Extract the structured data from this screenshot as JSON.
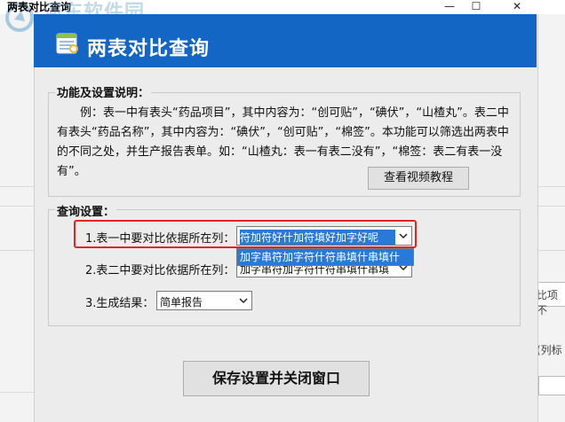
{
  "window": {
    "title": "两表对比查询",
    "minimize": "—",
    "maximize": "☐",
    "close": "✕",
    "watermark": "河东软件园"
  },
  "header": {
    "title": "两表对比查询"
  },
  "description": {
    "group_label": "功能及设置说明：",
    "text": "　　例：表一中有表头“药品项目”，其中内容为：“创可贴”，“碘伏”，“山楂丸”。表二中有表头“药品名称”，其中内容为：“碘伏”，“创可贴”，“棉签”。本功能可以筛选出两表中的不同之处，并生产报告表单。如：“山楂丸：表一有表二没有”，“棉签：表二有表一没有”。",
    "video_button": "查看视频教程"
  },
  "query": {
    "group_label": "查询设置：",
    "row1_label": "1.表一中要对比依据所在列：",
    "row1_value": "符加符好什加符填好加字好呢",
    "row2_label": "2.表二中要对比依据所在列：",
    "row2_value": "加字串符加字符什符串填什串填",
    "dropdown_item": "加字串符加字符什符串填什串填什",
    "row3_label": "3.生成结果：",
    "row3_value": "简单报告"
  },
  "save_button": "保存设置并关闭窗口",
  "background": {
    "right_text1": "比项不",
    "right_text2": "(列标"
  },
  "colors": {
    "header_blue": "#1466c4",
    "highlight_red": "#e0251f",
    "selection_blue": "#2979d9"
  }
}
